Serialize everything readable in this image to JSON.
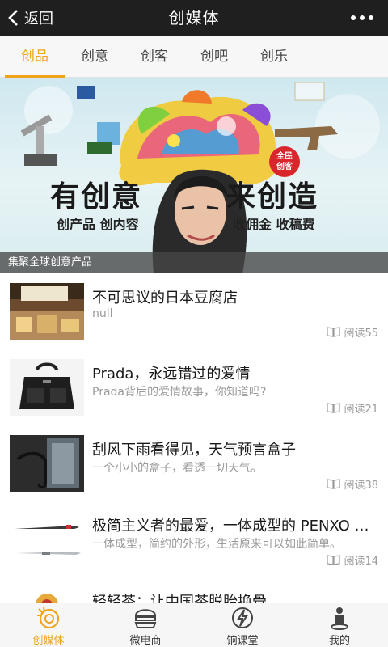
{
  "header": {
    "back_label": "返回",
    "title": "创媒体"
  },
  "tabs": [
    "创品",
    "创意",
    "创客",
    "创吧",
    "创乐"
  ],
  "banner": {
    "slogan_left": "有创意",
    "slogan_right": "来创造",
    "sub_left": "创产品 创内容",
    "sub_right": "收佣金 收稿费",
    "badge_line1": "全民",
    "badge_line2": "创客",
    "caption": "集聚全球创意产品"
  },
  "articles": [
    {
      "title": "不可思议的日本豆腐店",
      "subtitle": "null",
      "reads": "阅读55"
    },
    {
      "title": "Prada，永远错过的爱情",
      "subtitle": "Prada背后的爱情故事，你知道吗?",
      "reads": "阅读21"
    },
    {
      "title": "刮风下雨看得见，天气预言盒子",
      "subtitle": "一个小小的盒子，看透一切天气。",
      "reads": "阅读38"
    },
    {
      "title": "极简主义者的最爱，一体成型的 PENXO 钢笔",
      "subtitle": "一体成型，简约的外形，生活原来可以如此简单。",
      "reads": "阅读14"
    },
    {
      "title": "轻轻茶：让中国茶脱胎换骨",
      "subtitle": "",
      "reads": ""
    }
  ],
  "bottom_nav": [
    "创媒体",
    "微电商",
    "饷课堂",
    "我的"
  ],
  "colors": {
    "accent": "#f0a31b",
    "topbar": "#1f1f1f"
  }
}
